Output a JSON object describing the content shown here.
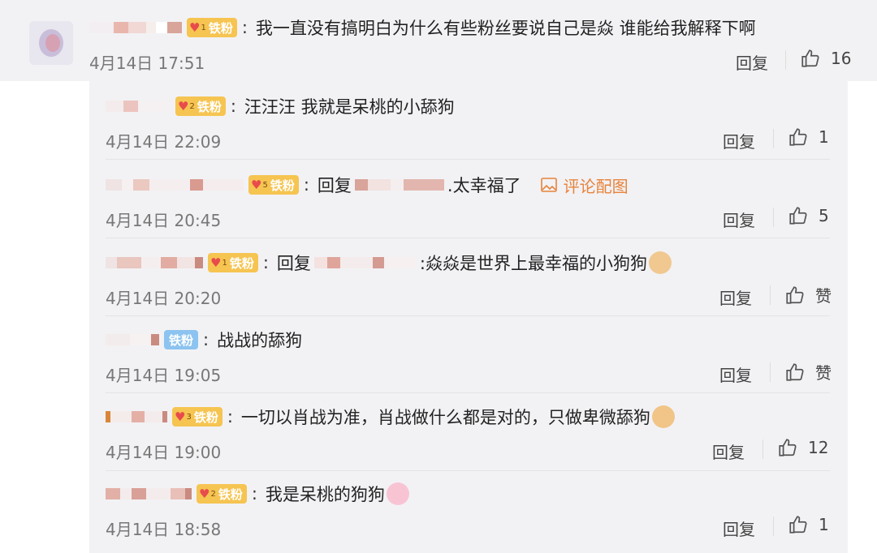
{
  "main": {
    "badge": "铁粉",
    "text": "我一直没有搞明白为什么有些粉丝要说自己是焱   谁能给我解释下啊",
    "time": "4月14日 17:51",
    "reply": "回复",
    "likes": "16"
  },
  "replies": [
    {
      "badge": "铁粉",
      "text": "汪汪汪 我就是呆桃的小舔狗",
      "time": "4月14日 22:09",
      "reply": "回复",
      "likes": "1"
    },
    {
      "badge": "铁粉",
      "prefix": "回复",
      "text": ".太幸福了",
      "pic": "评论配图",
      "time": "4月14日 20:45",
      "reply": "回复",
      "likes": "5"
    },
    {
      "badge": "铁粉",
      "prefix": "回复",
      "text": ":焱焱是世界上最幸福的小狗狗",
      "time": "4月14日 20:20",
      "reply": "回复",
      "likes": "赞"
    },
    {
      "badge": "铁粉",
      "text": "战战的舔狗",
      "time": "4月14日 19:05",
      "reply": "回复",
      "likes": "赞"
    },
    {
      "badge": "铁粉",
      "text": "一切以肖战为准，肖战做什么都是对的，只做卑微舔狗",
      "time": "4月14日 19:00",
      "reply": "回复",
      "likes": "12"
    },
    {
      "badge": "铁粉",
      "text": "我是呆桃的狗狗",
      "time": "4月14日 18:58",
      "reply": "回复",
      "likes": "1"
    }
  ],
  "colors": {
    "badge_gold": "#f6c451",
    "badge_blue": "#8cc3f0",
    "link_orange": "#e8833a",
    "panel_bg": "#f2f2f5"
  },
  "icons": [
    "thumb-up-icon",
    "image-icon",
    "heart-badge-icon"
  ]
}
